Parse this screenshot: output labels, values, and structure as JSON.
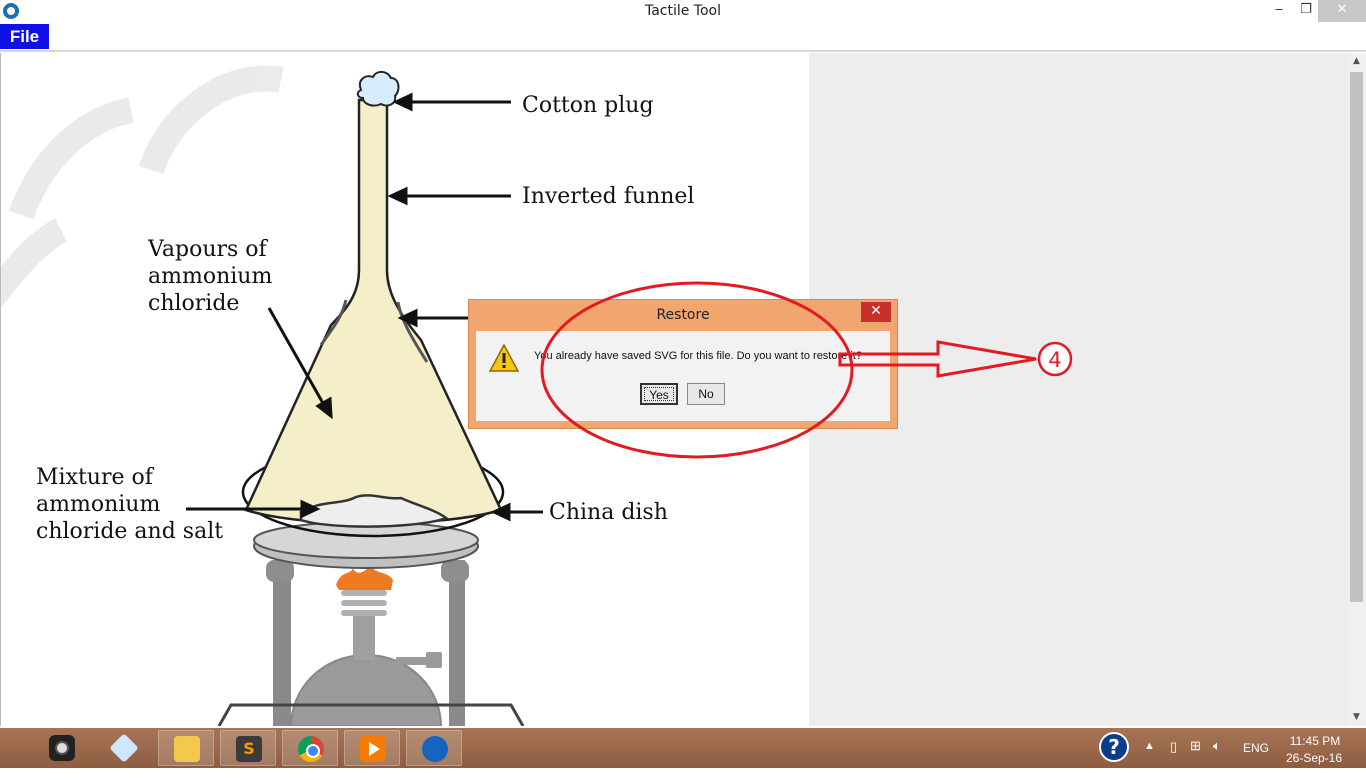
{
  "window": {
    "title": "Tactile Tool",
    "minimize_glyph": "‒",
    "maximize_glyph": "❐",
    "close_glyph": "✕"
  },
  "menubar": {
    "file_label": "File"
  },
  "diagram": {
    "labels": {
      "cotton_plug": "Cotton plug",
      "inverted_funnel": "Inverted funnel",
      "vapours_line1": "Vapours of",
      "vapours_line2": "ammonium",
      "vapours_line3": "chloride",
      "mixture_line1": "Mixture of",
      "mixture_line2": "ammonium",
      "mixture_line3": "chloride and salt",
      "china_dish": "China dish"
    },
    "colors": {
      "funnel_fill": "#f4efc9",
      "stand": "#888888",
      "flame": "#f07a20"
    }
  },
  "dialog": {
    "title": "Restore",
    "close_glyph": "✕",
    "message": "You already have saved SVG for this file. Do you want to restore it?",
    "yes_label": "Yes",
    "no_label": "No",
    "icon": "warning-icon"
  },
  "annotation": {
    "step_number": "4",
    "color": "#e21b23"
  },
  "taskbar": {
    "items": [
      "camera-app",
      "cube-app",
      "file-explorer",
      "sublime-text",
      "chrome",
      "media-player",
      "touch-tool"
    ],
    "help_glyph": "?",
    "language": "ENG",
    "time": "11:45 PM",
    "date": "26-Sep-16"
  }
}
